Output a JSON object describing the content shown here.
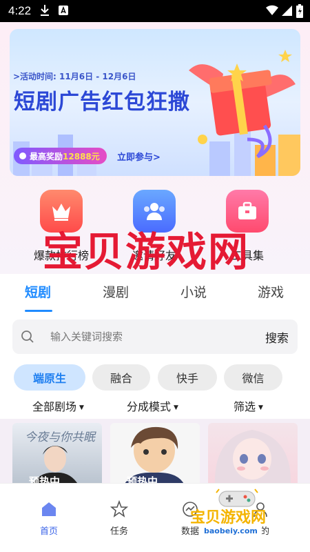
{
  "status_bar": {
    "time": "4:22"
  },
  "banner": {
    "date": ">活动时间: 11月6日 - 12月6日",
    "headline": "短剧广告红包狂撒",
    "reward_prefix": "最高奖励",
    "reward_amount": "12888元",
    "join": "立即参与>"
  },
  "quick_actions": [
    {
      "label": "爆款排行榜",
      "icon": "crown-icon"
    },
    {
      "label": "邀请好友",
      "icon": "users-icon"
    },
    {
      "label": "工具集",
      "icon": "toolbox-icon"
    }
  ],
  "watermark": "宝贝游戏网",
  "tabs": [
    "短剧",
    "漫剧",
    "小说",
    "游戏"
  ],
  "search": {
    "placeholder": "输入关键词搜索",
    "button": "搜索"
  },
  "chips": [
    "端原生",
    "融合",
    "快手",
    "微信"
  ],
  "filters": [
    "全部剧场",
    "分成模式",
    "筛选"
  ],
  "cards": [
    {
      "title_art": "今夜与你共眠",
      "badge": "预热中"
    },
    {
      "badge": "预热中"
    },
    {
      "badge": ""
    }
  ],
  "bottom_nav": [
    "首页",
    "任务",
    "数据",
    "我的"
  ],
  "bottom_watermark": {
    "text": "宝贝游戏网",
    "url": "baobeiy.com"
  },
  "colors": {
    "accent": "#1f8bff",
    "nav_active": "#3a63e8",
    "watermark": "#e5122c",
    "banner_title": "#2c48d6"
  }
}
